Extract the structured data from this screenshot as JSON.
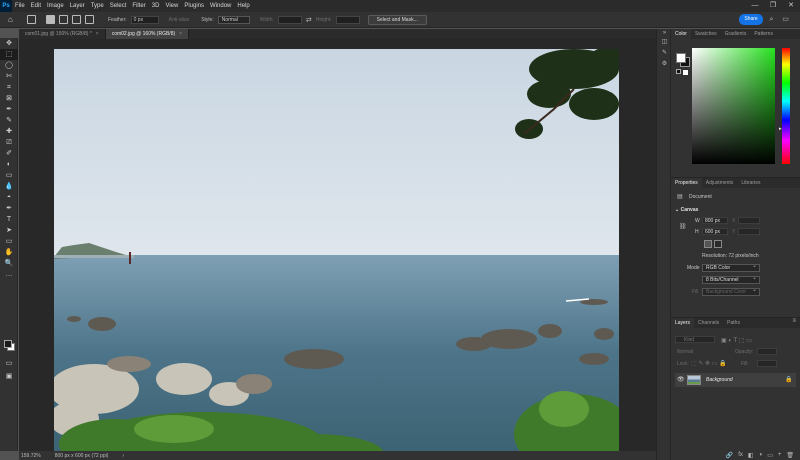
{
  "app": {
    "logo": "Ps"
  },
  "menu": [
    "File",
    "Edit",
    "Image",
    "Layer",
    "Type",
    "Select",
    "Filter",
    "3D",
    "View",
    "Plugins",
    "Window",
    "Help"
  ],
  "window_controls": [
    "—",
    "❐",
    "✕"
  ],
  "options_bar": {
    "feather_label": "Feather:",
    "feather_value": "0 px",
    "anti_alias": "Anti-alias",
    "style_label": "Style:",
    "style_value": "Normal",
    "width_label": "Width:",
    "height_label": "Height:",
    "select_mask": "Select and Mask...",
    "share": "Share"
  },
  "tabs": [
    {
      "label": "com01.jpg @ 150% (RGB/8) *",
      "active": false,
      "close": "×"
    },
    {
      "label": "com02.jpg @ 160% (RGB/8)",
      "active": true,
      "close": "×"
    }
  ],
  "status": {
    "zoom": "159.72%",
    "doc": "800 px x 600 px (72 ppi)",
    "arrow": "›"
  },
  "tools": [
    "✥",
    "⬚",
    "◯",
    "✄",
    "⌗",
    "⊠",
    "✒",
    "✎",
    "✚",
    "⎚",
    "✐",
    "◐",
    "▭",
    "💧",
    "◓",
    "✒",
    "T",
    "➤",
    "▭",
    "✋",
    "🔍",
    "…"
  ],
  "color_panel": {
    "tabs": [
      "Color",
      "Swatches",
      "Gradients",
      "Patterns"
    ],
    "active_tab": "Color"
  },
  "properties_panel": {
    "tabs": [
      "Properties",
      "Adjustments",
      "Libraries"
    ],
    "document_label": "Document",
    "canvas_label": "Canvas",
    "w_label": "W",
    "w_value": "800 px",
    "h_label": "H",
    "h_value": "600 px",
    "x_label": "X",
    "y_label": "Y",
    "resolution": "Resolution: 72 pixels/inch",
    "mode_label": "Mode",
    "mode_value": "RGB Color",
    "bits_value": "8 Bits/Channel",
    "fill_label": "Fill",
    "fill_value": "Background Color"
  },
  "layers_panel": {
    "tabs": [
      "Layers",
      "Channels",
      "Paths"
    ],
    "search_placeholder": "Kind",
    "blend_mode": "Normal",
    "opacity_label": "Opacity:",
    "lock_label": "Lock:",
    "fill_label": "Fill:",
    "layer_name": "Background"
  },
  "layers_bottom_icons": [
    "🔗",
    "fx",
    "◧",
    "◑",
    "▭",
    "+",
    "🗑"
  ]
}
